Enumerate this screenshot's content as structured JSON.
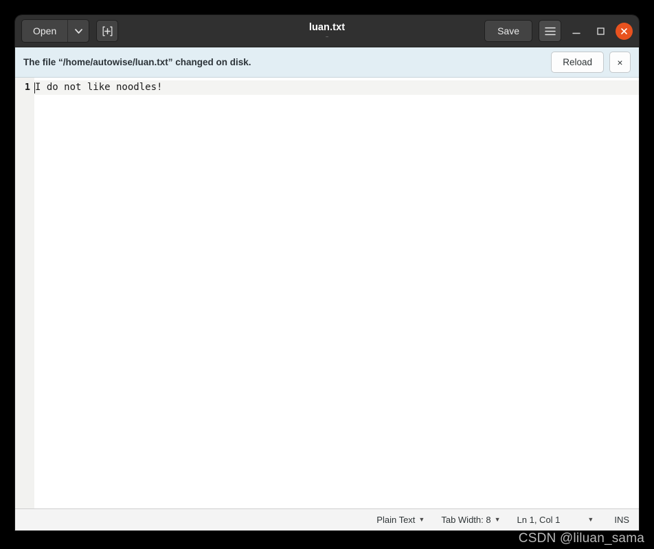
{
  "window": {
    "title": "luan.txt",
    "subtitle": "~"
  },
  "header": {
    "open_label": "Open",
    "open_dropdown_icon": "chevron-down-icon",
    "new_document_icon": "new-document-icon",
    "save_label": "Save",
    "menu_icon": "hamburger-menu-icon",
    "minimize_icon": "minimize-icon",
    "maximize_icon": "maximize-icon",
    "close_icon": "close-icon",
    "close_color": "#e8521f"
  },
  "infobar": {
    "message": "The file “/home/autowise/luan.txt” changed on disk.",
    "reload_label": "Reload",
    "dismiss_label": "×",
    "background": "#e2eef4"
  },
  "editor": {
    "lines": [
      {
        "number": "1",
        "text": "I do not like noodles!"
      }
    ]
  },
  "statusbar": {
    "language": "Plain Text",
    "tab_width": "Tab Width: 8",
    "position": "Ln 1, Col 1",
    "insert_mode": "INS",
    "dropdown_icon": "chevron-down-icon"
  },
  "watermark": {
    "text": "CSDN @liluan_sama"
  }
}
